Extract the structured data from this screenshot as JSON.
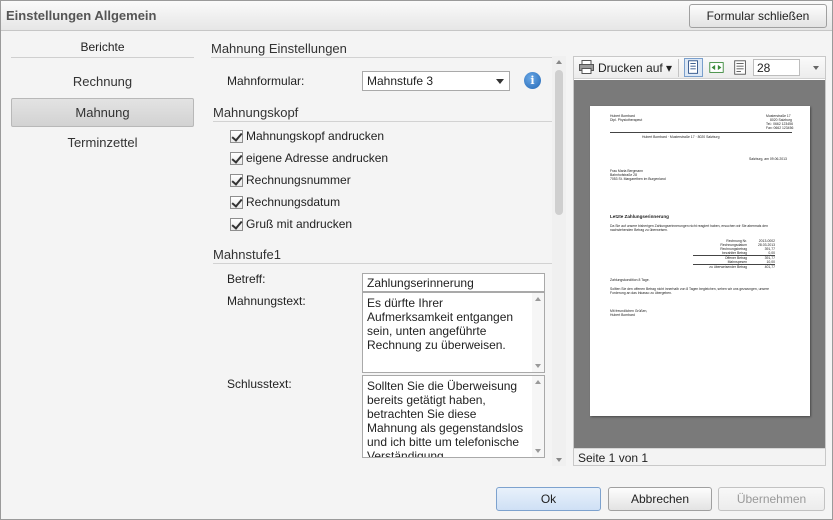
{
  "window": {
    "title": "Einstellungen Allgemein",
    "close_button": "Formular schließen"
  },
  "nav": {
    "header": "Berichte",
    "items": [
      {
        "label": "Rechnung",
        "active": false
      },
      {
        "label": "Mahnung",
        "active": true
      },
      {
        "label": "Terminzettel",
        "active": false
      }
    ]
  },
  "settings": {
    "title": "Mahnung Einstellungen",
    "mahnformular_label": "Mahnformular:",
    "mahnformular_value": "Mahnstufe 3",
    "info_icon_glyph": "i",
    "kopf": {
      "title": "Mahnungskopf",
      "checks": [
        {
          "label": "Mahnungskopf andrucken",
          "checked": true
        },
        {
          "label": "eigene Adresse andrucken",
          "checked": true
        },
        {
          "label": "Rechnungsnummer",
          "checked": true
        },
        {
          "label": "Rechnungsdatum",
          "checked": true
        },
        {
          "label": "Gruß mit andrucken",
          "checked": true
        }
      ]
    },
    "stufe": {
      "title": "Mahnstufe1",
      "betreff_label": "Betreff:",
      "betreff_value": "Zahlungserinnerung",
      "text_label": "Mahnungstext:",
      "text_value": "Es dürfte Ihrer Aufmerksamkeit entgangen sein, unten angeführte Rechnung zu überweisen.",
      "schluss_label": "Schlusstext:",
      "schluss_value": "Sollten Sie die Überweisung bereits getätigt haben, betrachten Sie diese Mahnung als gegenstandslos und ich bitte um telefonische Verständigung."
    }
  },
  "preview": {
    "print_label": "Drucken auf",
    "pages_value": "28",
    "status": "Seite 1 von 1",
    "doc": {
      "sender_name": "Hubert Bombard",
      "sender_title": "Dipl. Physiotherapeut",
      "sender_street": "Musterstraße 17",
      "sender_city": "8020 Salzburg",
      "sender_tel": "Tel.: 0662 123456",
      "sender_fax": "Fax: 0662 123456",
      "return_line": "Hubert Bombard · Musterstraße 17 · 8020 Salzburg",
      "date_line": "Salzburg, am 09.06.2013",
      "recipient_1": "Frau Maria Bergmann",
      "recipient_2": "Bahnhofstraße 28",
      "recipient_3": "7053 St. Margarethen im Burgenland",
      "heading": "Letzte Zahlungserinnerung",
      "body_1": "Da Sie auf unsere bisherigen Zahlungserinnerungen nicht reagiert haben, ersuchen wir Sie abermals den",
      "body_2": "nachstehenden Betrag zu überweisen.",
      "rows": [
        {
          "label": "Rechnung Nr.",
          "value": "2013-0002"
        },
        {
          "label": "Rechnungsdatum",
          "value": "28.03.2013"
        },
        {
          "label": "Rechnungsbetrag",
          "value": "391,77"
        },
        {
          "label": "bezahlter Betrag",
          "value": "0,00"
        },
        {
          "label": "Offener Betrag",
          "value": "391,77"
        },
        {
          "label": "Mahnspesen",
          "value": "10,00"
        },
        {
          "label": "zu überweisender Betrag",
          "value": "401,77"
        }
      ],
      "terms": "Zahlungskondition 8 Tage.",
      "closing_1": "Sollten Sie den offenen Betrag nicht innerhalb von 8 Tagen begleichen, sehen wir uns gezwungen, unsere",
      "closing_2": "Forderung an das Inkasso zu übergeben.",
      "greeting": "Mit freundlichen Grüßen,",
      "signature": "Hubert Bombard"
    }
  },
  "footer": {
    "ok": "Ok",
    "cancel": "Abbrechen",
    "apply": "Übernehmen"
  }
}
